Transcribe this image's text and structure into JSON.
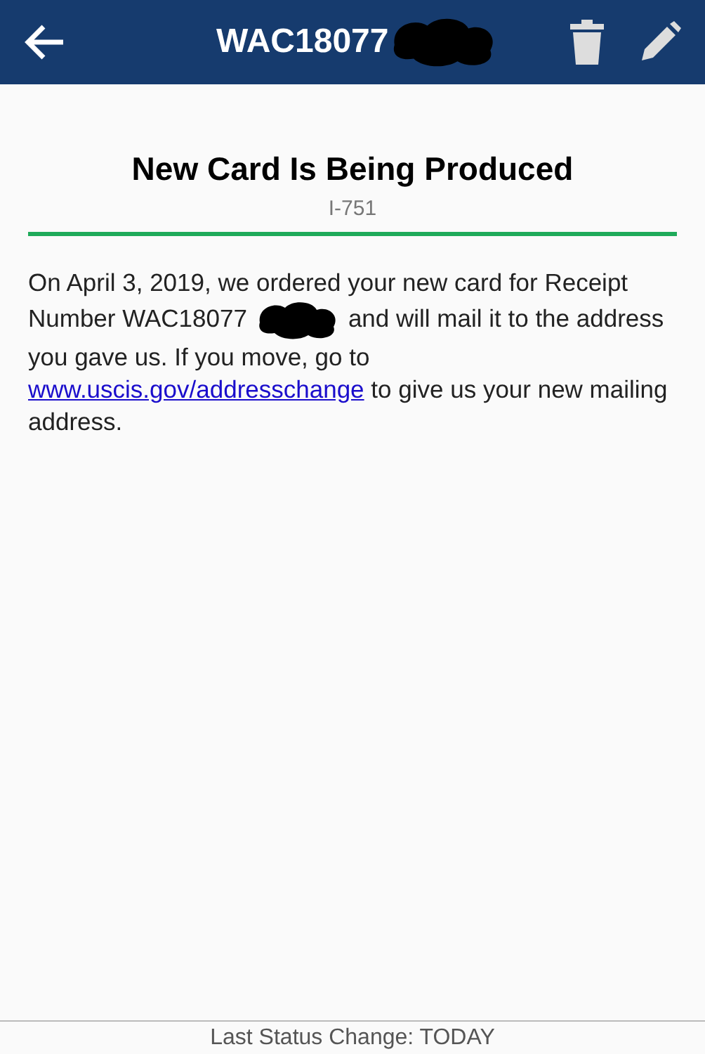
{
  "header": {
    "title": "WAC18077"
  },
  "card": {
    "heading": "New Card Is Being Produced",
    "form": "I-751",
    "text_before": "On April 3, 2019, we ordered your new card for Receipt Number WAC18077",
    "text_after": "and will mail it to the address you gave us. If you move, go to",
    "link": "www.uscis.gov/addresschange",
    "text_end": "to give us your new mailing address."
  },
  "footer": {
    "status": "Last Status Change: TODAY"
  }
}
